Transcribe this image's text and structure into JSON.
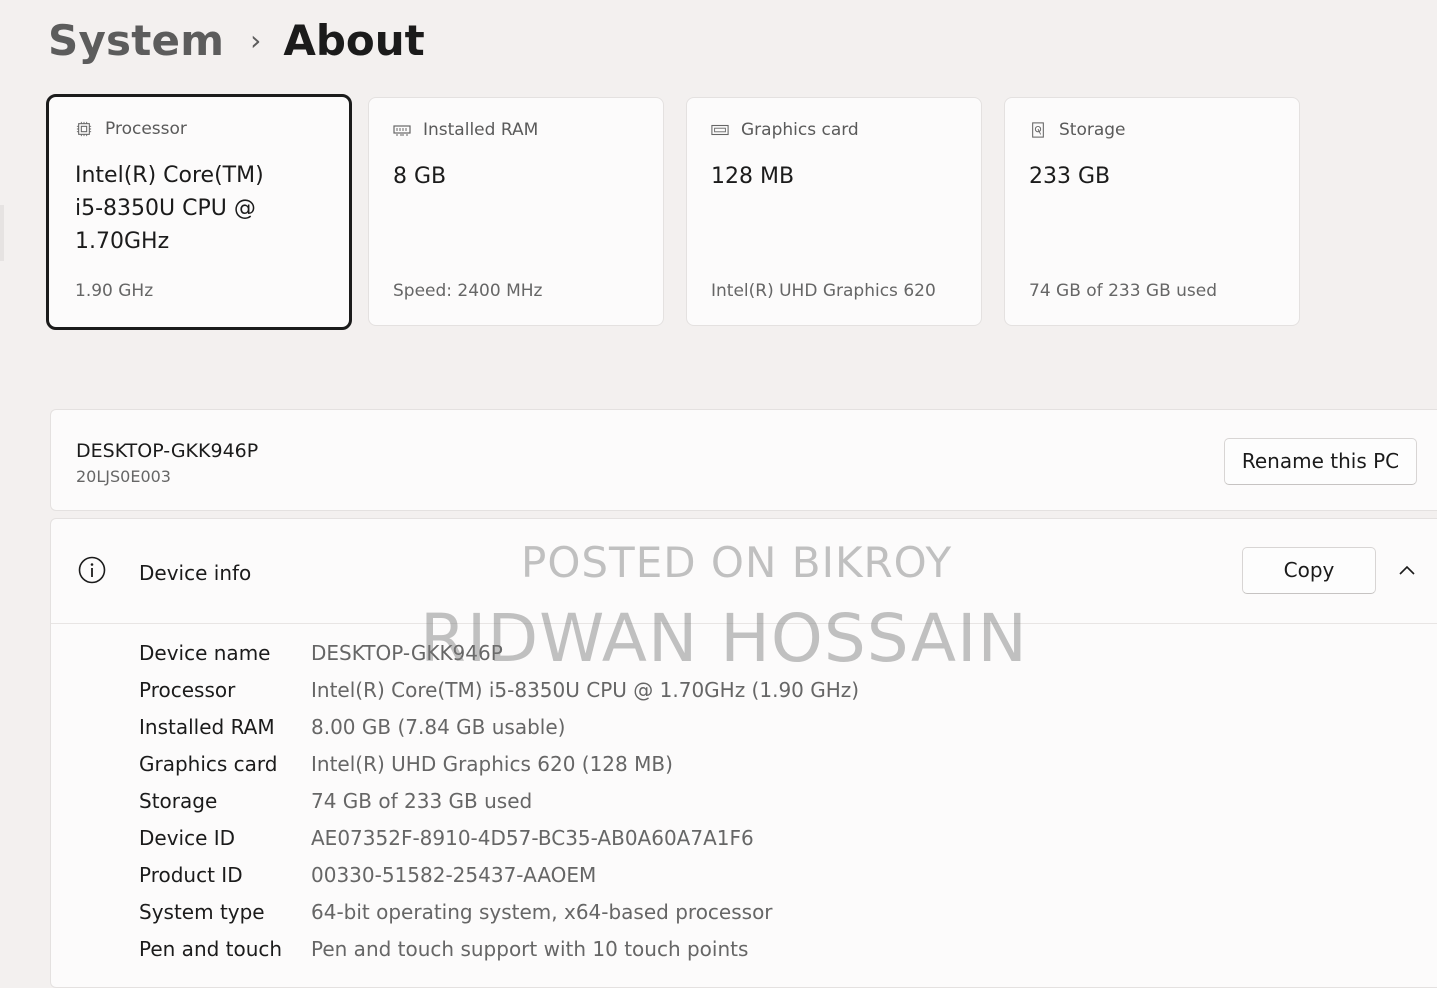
{
  "breadcrumb": {
    "parent": "System",
    "separator": "›",
    "current": "About"
  },
  "cards": [
    {
      "label": "Processor",
      "icon": "processor-icon",
      "value": "Intel(R) Core(TM) i5-8350U CPU @ 1.70GHz",
      "sub": "1.90 GHz"
    },
    {
      "label": "Installed RAM",
      "icon": "ram-icon",
      "value": "8 GB",
      "sub": "Speed: 2400 MHz"
    },
    {
      "label": "Graphics card",
      "icon": "graphics-card-icon",
      "value": "128 MB",
      "sub": "Intel(R) UHD Graphics 620"
    },
    {
      "label": "Storage",
      "icon": "storage-icon",
      "value": "233 GB",
      "sub": "74 GB of 233 GB used"
    }
  ],
  "pc": {
    "name": "DESKTOP-GKK946P",
    "model": "20LJS0E003",
    "rename_label": "Rename this PC"
  },
  "device_info": {
    "title": "Device info",
    "copy_label": "Copy",
    "rows": [
      {
        "label": "Device name",
        "value": "DESKTOP-GKK946P"
      },
      {
        "label": "Processor",
        "value": "Intel(R) Core(TM) i5-8350U CPU @ 1.70GHz (1.90 GHz)"
      },
      {
        "label": "Installed RAM",
        "value": "8.00 GB (7.84 GB usable)"
      },
      {
        "label": "Graphics card",
        "value": "Intel(R) UHD Graphics 620 (128 MB)"
      },
      {
        "label": "Storage",
        "value": "74 GB of 233 GB used"
      },
      {
        "label": "Device ID",
        "value": "AE07352F-8910-4D57-BC35-AB0A60A7A1F6"
      },
      {
        "label": "Product ID",
        "value": "00330-51582-25437-AAOEM"
      },
      {
        "label": "System type",
        "value": "64-bit operating system, x64-based processor"
      },
      {
        "label": "Pen and touch",
        "value": "Pen and touch support with 10 touch points"
      }
    ]
  },
  "watermark": {
    "line1": "POSTED ON BIKROY",
    "line2": "RIDWAN HOSSAIN"
  }
}
